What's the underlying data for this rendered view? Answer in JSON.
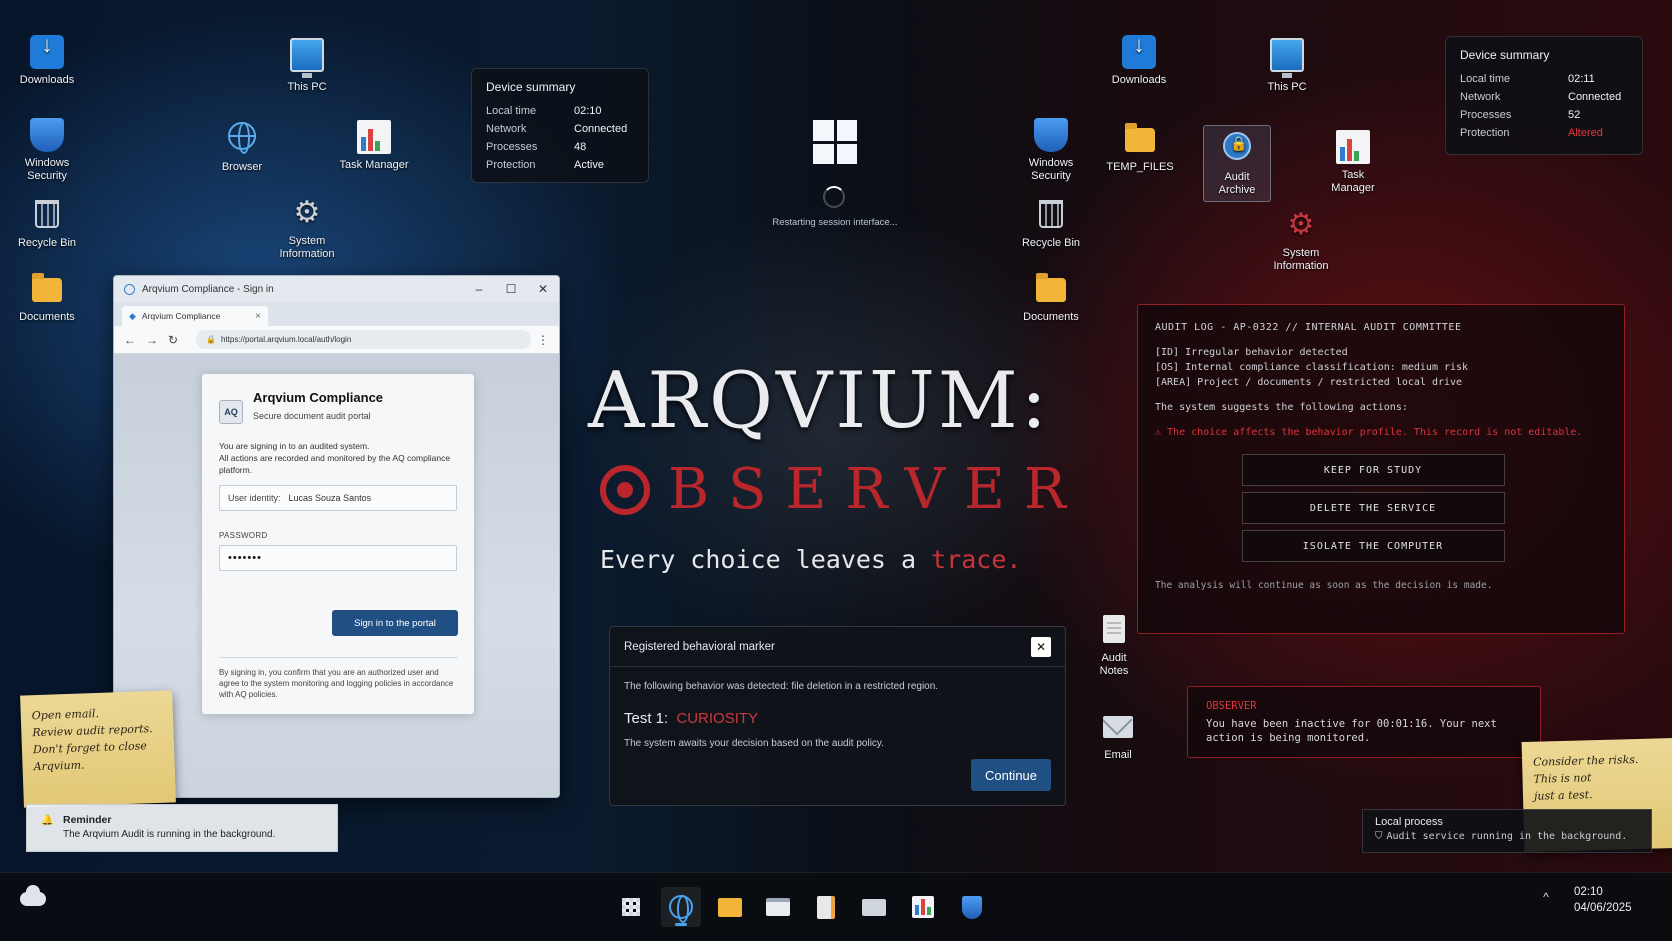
{
  "desktop_left": {
    "downloads": "Downloads",
    "this_pc": "This PC",
    "windows_security": "Windows Security",
    "browser": "Browser",
    "task_manager": "Task Manager",
    "recycle_bin": "Recycle Bin",
    "system_information": "System Information",
    "documents": "Documents"
  },
  "desktop_right": {
    "downloads": "Downloads",
    "this_pc": "This PC",
    "windows_security": "Windows Security",
    "temp_files": "TEMP_FILES",
    "audit_archive": "Audit Archive",
    "task_manager": "Task Manager",
    "recycle_bin": "Recycle Bin",
    "system_information": "System Information",
    "documents": "Documents",
    "audit_notes": "Audit Notes",
    "email": "Email"
  },
  "device_summary_left": {
    "title": "Device summary",
    "rows": [
      {
        "label": "Local time",
        "value": "02:10"
      },
      {
        "label": "Network",
        "value": "Connected"
      },
      {
        "label": "Processes",
        "value": "48"
      },
      {
        "label": "Protection",
        "value": "Active"
      }
    ]
  },
  "device_summary_right": {
    "title": "Device summary",
    "rows": [
      {
        "label": "Local time",
        "value": "02:11"
      },
      {
        "label": "Network",
        "value": "Connected"
      },
      {
        "label": "Processes",
        "value": "52"
      },
      {
        "label": "Protection",
        "value": "Altered"
      }
    ],
    "alert_color": "#e0393e"
  },
  "session": {
    "status": "Restarting session interface..."
  },
  "browser": {
    "window_title": "Arqvium Compliance - Sign in",
    "tab_label": "Arqvium Compliance",
    "url": "https://portal.arqvium.local/auth/login",
    "login": {
      "logo_text": "AQ",
      "title": "Arqvium Compliance",
      "subtitle": "Secure document audit portal",
      "message_1": "You are signing in to an audited system.",
      "message_2": "All actions are recorded and monitored by the AQ compliance platform.",
      "identity_label": "User identity:",
      "identity_value": "Lucas Souza Santos",
      "password_label": "PASSWORD",
      "password_value": "•••••••",
      "signin_label": "Sign in to the portal",
      "fine_print": "By signing in, you confirm that you are an authorized user and agree to the system monitoring and logging policies in accordance with AQ policies."
    }
  },
  "sticky_left": {
    "lines": [
      "Open email.",
      "Review audit reports.",
      "Don't forget to close",
      "Arqvium."
    ]
  },
  "sticky_right": {
    "lines": [
      "Consider the risks.",
      "This is not",
      "just a test."
    ]
  },
  "reminder": {
    "title": "Reminder",
    "body": "The Arqvium Audit is running in the background."
  },
  "brand": {
    "line1": "ARQVIUM:",
    "line2": "BSERVER",
    "tagline_main": "Every choice leaves a",
    "tagline_accent": "trace.",
    "accent_color": "#c8343a"
  },
  "marker_dialog": {
    "title": "Registered behavioral marker",
    "detected": "The following behavior was detected: file deletion in a restricted region.",
    "test_label": "Test 1:",
    "test_value": "CURIOSITY",
    "awaits": "The system awaits your decision based on the audit policy.",
    "continue_label": "Continue"
  },
  "audit_log": {
    "header": "AUDIT LOG - AP-0322 // INTERNAL AUDIT COMMITTEE",
    "lines": [
      "[ID] Irregular behavior detected",
      "[OS] Internal compliance classification: medium risk",
      "[AREA] Project / documents / restricted local drive"
    ],
    "suggestion": "The system suggests the following actions:",
    "warning": "⚠ The choice affects the behavior profile. This record is not editable.",
    "actions": [
      "KEEP FOR STUDY",
      "DELETE THE SERVICE",
      "ISOLATE THE COMPUTER"
    ],
    "footer": "The analysis will continue as soon as the decision is made."
  },
  "observer_notice": {
    "title": "OBSERVER",
    "body": "You have been inactive for 00:01:16. Your next action is being monitored."
  },
  "local_process": {
    "title": "Local process",
    "body": "Audit service running in the background."
  },
  "taskbar": {
    "time": "02:10",
    "date": "04/06/2025"
  }
}
